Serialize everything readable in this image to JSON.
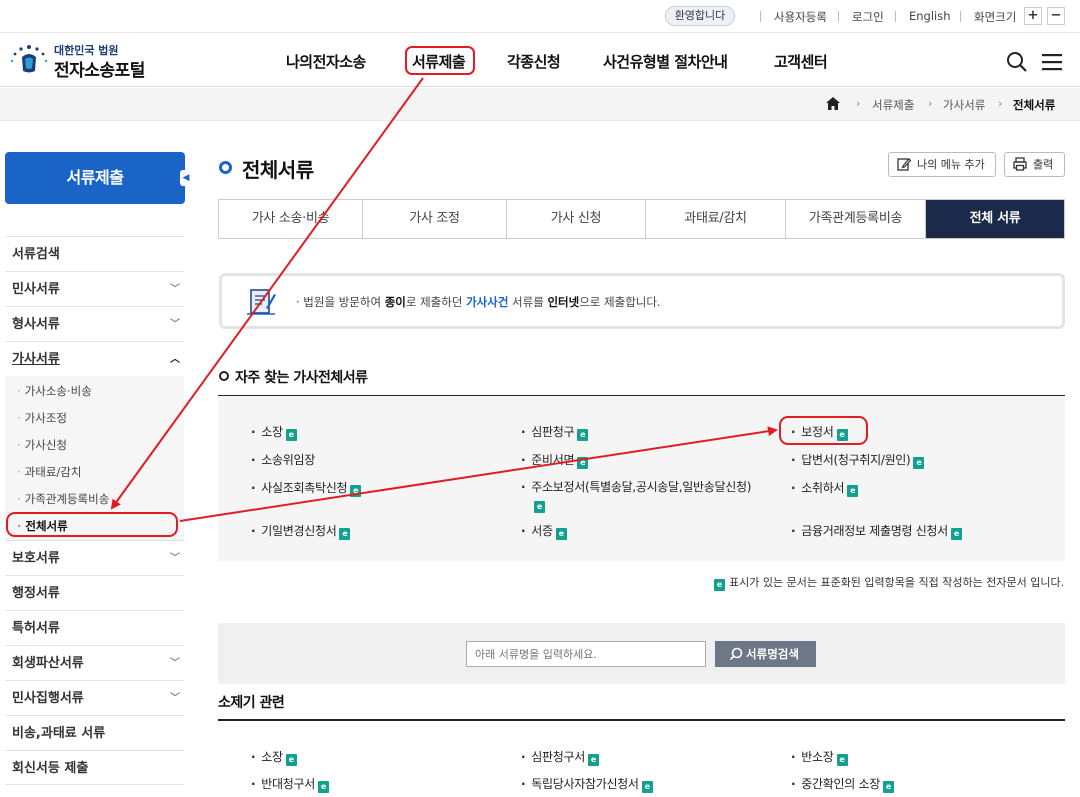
{
  "topbar": {
    "welcome": "환영합니다",
    "register": "사용자등록",
    "login": "로그인",
    "english": "English",
    "fontsize": "화면크기",
    "plus": "+",
    "minus": "−"
  },
  "header": {
    "logo_top": "대한민국 법원",
    "logo_main": "전자소송포털",
    "nav": [
      "나의전자소송",
      "서류제출",
      "각종신청",
      "사건유형별 절차안내",
      "고객센터"
    ]
  },
  "breadcrumb": [
    "서류제출",
    "가사서류",
    "전체서류"
  ],
  "sidebar": {
    "title": "서류제출",
    "items": [
      "서류검색",
      "민사서류",
      "형사서류",
      "가사서류",
      "보호서류",
      "행정서류",
      "특허서류",
      "회생파산서류",
      "민사집행서류",
      "비송,과태료 서류",
      "회신서등 제출"
    ],
    "sub_items": [
      "가사소송·비송",
      "가사조정",
      "가사신청",
      "과태료/감치",
      "가족관계등록비송",
      "전체서류"
    ]
  },
  "main": {
    "page_title": "전체서류",
    "my_menu_label": "나의 메뉴 추가",
    "print_label": "출력",
    "tabs": [
      "가사 소송·비송",
      "가사 조정",
      "가사 신청",
      "과태료/감치",
      "가족관계등록비송",
      "전체 서류"
    ],
    "notice": {
      "t1": "· 법원을 방문하여 ",
      "t2": "종이",
      "t3": "로 제출하던 ",
      "t4": "가사사건",
      "t5": " 서류를 ",
      "t6": "인터넷",
      "t7": "으로 제출합니다."
    },
    "freq_title": "자주 찾는 가사전체서류",
    "freq_docs": [
      "소장",
      "심판청구",
      "보정서",
      "소송위임장",
      "준비서면",
      "답변서(청구취지/원인)",
      "사실조회촉탁신청",
      "주소보정서(특별송달,공시송달,일반송달신청)",
      "소취하서",
      "기일변경신청서",
      "서증",
      "금융거래정보 제출명령 신청서"
    ],
    "legend": "표시가 있는 문서는 표준화된 입력항목을 직접 작성하는 전자문서 입니다.",
    "search_placeholder": "아래 서류명을 입력하세요.",
    "search_button": "서류명검색",
    "section2_title": "소제기 관련",
    "section2_docs": [
      "소장",
      "심판청구서",
      "반소장",
      "반대청구서",
      "독립당사자참가신청서",
      "중간확인의 소장"
    ],
    "e_icon": "e"
  },
  "colors": {
    "accent_blue": "#1a64c8",
    "tab_active": "#1b2a4a",
    "annotation_red": "#e31b23",
    "e_icon_teal": "#13a08e"
  }
}
